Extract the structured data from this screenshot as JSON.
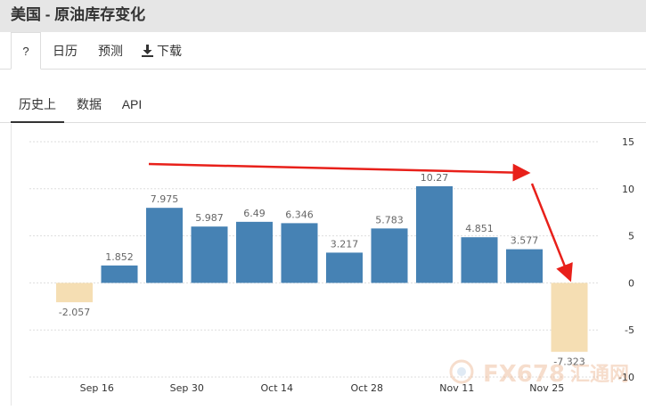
{
  "window": {
    "title": "美国 - 原油库存变化"
  },
  "toolbar": {
    "help_label": "?",
    "calendar_label": "日历",
    "forecast_label": "预测",
    "download_label": "下载"
  },
  "tabs": [
    {
      "label": "历史上",
      "active": true
    },
    {
      "label": "数据",
      "active": false
    },
    {
      "label": "API",
      "active": false
    }
  ],
  "watermark": {
    "text": "FX678",
    "subtext": "汇通网"
  },
  "colors": {
    "positive": "#4682b4",
    "negative": "#f5deb3",
    "arrow": "#e8201a",
    "grid": "#dddddd"
  },
  "chart_data": {
    "type": "bar",
    "values": [
      -2.057,
      1.852,
      7.975,
      5.987,
      6.49,
      6.346,
      3.217,
      5.783,
      10.27,
      4.851,
      3.577,
      -7.323
    ],
    "data_labels": [
      "-2.057",
      "1.852",
      "7.975",
      "5.987",
      "6.49",
      "6.346",
      "3.217",
      "5.783",
      "10.27",
      "4.851",
      "3.577",
      "-7.323"
    ],
    "x_ticks": [
      {
        "label": "Sep 16",
        "index": 0.5
      },
      {
        "label": "Sep 30",
        "index": 2.5
      },
      {
        "label": "Oct 14",
        "index": 4.5
      },
      {
        "label": "Oct 28",
        "index": 6.5
      },
      {
        "label": "Nov 11",
        "index": 8.5
      },
      {
        "label": "Nov 25",
        "index": 10.5
      }
    ],
    "y_ticks": [
      "15",
      "10",
      "5",
      "0",
      "-5",
      "-10"
    ],
    "ylim": [
      -10,
      15
    ],
    "grid": true,
    "y_axis_position": "right"
  }
}
